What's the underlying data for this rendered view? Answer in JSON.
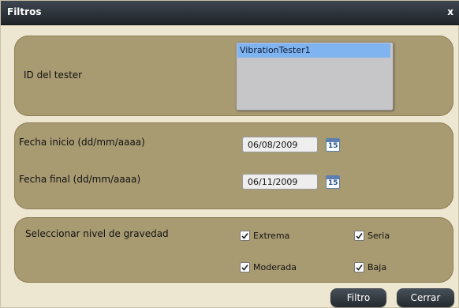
{
  "dialog": {
    "title": "Filtros",
    "close_label": "x"
  },
  "tester": {
    "label": "ID del tester",
    "items": [
      "VibrationTester1"
    ]
  },
  "dates": {
    "start_label": "Fecha inicio (dd/mm/aaaa)",
    "start_value": "06/08/2009",
    "end_label": "Fecha final (dd/mm/aaaa)",
    "end_value": "06/11/2009",
    "calendar_icon_text": "15"
  },
  "severity": {
    "label": "Seleccionar nivel de gravedad",
    "options": [
      {
        "label": "Extrema",
        "checked": true
      },
      {
        "label": "Seria",
        "checked": true
      },
      {
        "label": "Moderada",
        "checked": true
      },
      {
        "label": "Baja",
        "checked": true
      }
    ]
  },
  "buttons": {
    "filter": "Filtro",
    "close": "Cerrar"
  },
  "colors": {
    "panel": "#a89a71",
    "titlebar": "#2a3037",
    "selection": "#7fb4f1"
  }
}
